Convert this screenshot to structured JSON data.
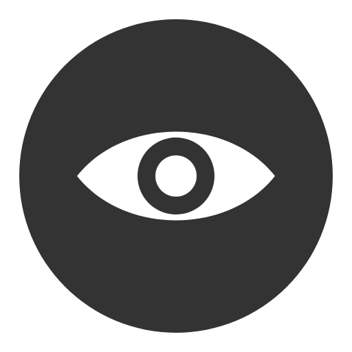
{
  "icon": {
    "name": "eye-icon",
    "colors": {
      "background": "#ffffff",
      "disc": "#333333",
      "eye": "#ffffff",
      "iris": "#333333",
      "pupil": "#ffffff"
    }
  }
}
